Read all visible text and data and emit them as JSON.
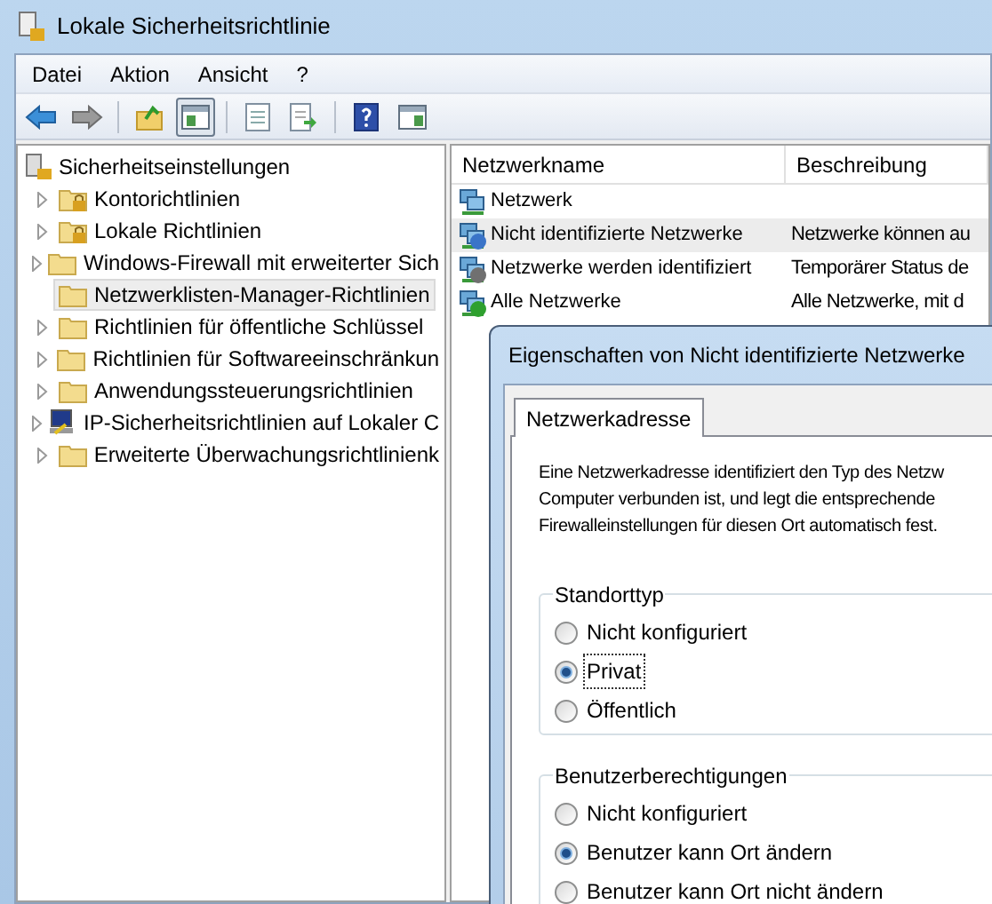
{
  "window": {
    "title": "Lokale Sicherheitsrichtlinie"
  },
  "menu": [
    "Datei",
    "Aktion",
    "Ansicht",
    "?"
  ],
  "toolbar": [
    {
      "kind": "back",
      "selected": false
    },
    {
      "kind": "forward",
      "selected": false
    },
    {
      "kind": "sep"
    },
    {
      "kind": "up",
      "selected": false
    },
    {
      "kind": "tree",
      "selected": true
    },
    {
      "kind": "sep"
    },
    {
      "kind": "props",
      "selected": false
    },
    {
      "kind": "export",
      "selected": false
    },
    {
      "kind": "sep"
    },
    {
      "kind": "help",
      "selected": false
    },
    {
      "kind": "pane",
      "selected": false
    }
  ],
  "tree": {
    "label": "Sicherheitseinstellungen",
    "children": [
      {
        "label": "Kontorichtlinien",
        "kind": "locked",
        "expandable": true,
        "selected": false
      },
      {
        "label": "Lokale Richtlinien",
        "kind": "locked",
        "expandable": true,
        "selected": false
      },
      {
        "label": "Windows-Firewall mit erweiterter Sich",
        "kind": "folder",
        "expandable": true,
        "selected": false
      },
      {
        "label": "Netzwerklisten-Manager-Richtlinien",
        "kind": "folder",
        "expandable": false,
        "selected": true
      },
      {
        "label": "Richtlinien für öffentliche Schlüssel",
        "kind": "folder",
        "expandable": true,
        "selected": false
      },
      {
        "label": "Richtlinien für Softwareeinschränkun",
        "kind": "folder",
        "expandable": true,
        "selected": false
      },
      {
        "label": "Anwendungssteuerungsrichtlinien",
        "kind": "folder",
        "expandable": true,
        "selected": false
      },
      {
        "label": "IP-Sicherheitsrichtlinien auf Lokaler C",
        "kind": "computer",
        "expandable": true,
        "selected": false
      },
      {
        "label": "Erweiterte Überwachungsrichtlinienk",
        "kind": "folder",
        "expandable": true,
        "selected": false
      }
    ]
  },
  "list": {
    "columns": [
      "Netzwerkname",
      "Beschreibung"
    ],
    "rows": [
      {
        "name": "Netzwerk",
        "description": "",
        "kind": "plain",
        "selected": false
      },
      {
        "name": "Nicht identifizierte Netzwerke",
        "description": "Netzwerke können au",
        "kind": "unknown",
        "selected": true
      },
      {
        "name": "Netzwerke werden identifiziert",
        "description": "Temporärer Status de",
        "kind": "pending",
        "selected": false
      },
      {
        "name": "Alle Netzwerke",
        "description": "Alle Netzwerke, mit d",
        "kind": "ok",
        "selected": false
      }
    ]
  },
  "dialog": {
    "title": "Eigenschaften von Nicht identifizierte Netzwerke",
    "tabs": [
      {
        "label": "Netzwerkadresse",
        "selected": true
      }
    ],
    "description": [
      "Eine Netzwerkadresse identifiziert den Typ des Netzw",
      "Computer verbunden ist, und legt die entsprechende",
      "Firewalleinstellungen für diesen Ort automatisch fest."
    ],
    "groups": [
      {
        "title": "Standorttyp",
        "options": [
          {
            "label": "Nicht konfiguriert",
            "selected": false,
            "focused": false
          },
          {
            "label": "Privat",
            "selected": true,
            "focused": true
          },
          {
            "label": "Öffentlich",
            "selected": false,
            "focused": false
          }
        ]
      },
      {
        "title": "Benutzerberechtigungen",
        "options": [
          {
            "label": "Nicht konfiguriert",
            "selected": false,
            "focused": false
          },
          {
            "label": "Benutzer kann Ort ändern",
            "selected": true,
            "focused": false
          },
          {
            "label": "Benutzer kann Ort nicht ändern",
            "selected": false,
            "focused": false
          }
        ]
      }
    ]
  }
}
